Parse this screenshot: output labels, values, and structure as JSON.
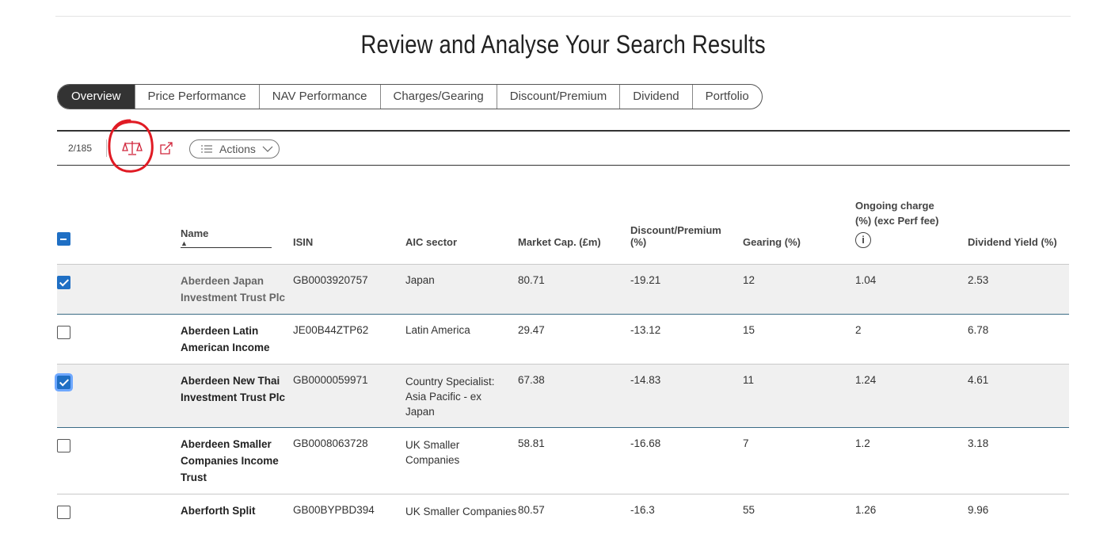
{
  "title": "Review and Analyse Your Search Results",
  "tabs": [
    {
      "label": "Overview",
      "active": true
    },
    {
      "label": "Price Performance"
    },
    {
      "label": "NAV Performance"
    },
    {
      "label": "Charges/Gearing"
    },
    {
      "label": "Discount/Premium"
    },
    {
      "label": "Dividend"
    },
    {
      "label": "Portfolio"
    }
  ],
  "toolbar": {
    "count": "2/185",
    "compare_icon": "scales-icon",
    "export_icon": "external-link-icon",
    "actions_label": "Actions",
    "accent_color": "#d0243a"
  },
  "table": {
    "headers": {
      "name": "Name",
      "isin": "ISIN",
      "sector": "AIC sector",
      "market_cap": "Market Cap. (£m)",
      "discount_premium": "Discount/Premium (%)",
      "gearing": "Gearing (%)",
      "ongoing_charge": "Ongoing charge (%) (exc Perf fee)",
      "dividend_yield": "Dividend Yield (%)"
    },
    "rows": [
      {
        "checked": true,
        "name": "Aberdeen Japan Investment Trust Plc",
        "isin": "GB0003920757",
        "sector": "Japan",
        "market_cap": "80.71",
        "discount": "-19.21",
        "gearing": "12",
        "charge": "1.04",
        "yield": "2.53"
      },
      {
        "checked": false,
        "name": "Aberdeen Latin American Income",
        "isin": "JE00B44ZTP62",
        "sector": "Latin America",
        "market_cap": "29.47",
        "discount": "-13.12",
        "gearing": "15",
        "charge": "2",
        "yield": "6.78"
      },
      {
        "checked": true,
        "name": "Aberdeen New Thai Investment Trust Plc",
        "isin": "GB0000059971",
        "sector": "Country Specialist: Asia Pacific - ex Japan",
        "market_cap": "67.38",
        "discount": "-14.83",
        "gearing": "11",
        "charge": "1.24",
        "yield": "4.61"
      },
      {
        "checked": false,
        "name": "Aberdeen Smaller Companies Income Trust",
        "isin": "GB0008063728",
        "sector": "UK Smaller Companies",
        "market_cap": "58.81",
        "discount": "-16.68",
        "gearing": "7",
        "charge": "1.2",
        "yield": "3.18"
      },
      {
        "checked": false,
        "name": "Aberforth Split",
        "isin": "GB00BYPBD394",
        "sector": "UK Smaller Companies",
        "market_cap": "80.57",
        "discount": "-16.3",
        "gearing": "55",
        "charge": "1.26",
        "yield": "9.96"
      }
    ]
  }
}
